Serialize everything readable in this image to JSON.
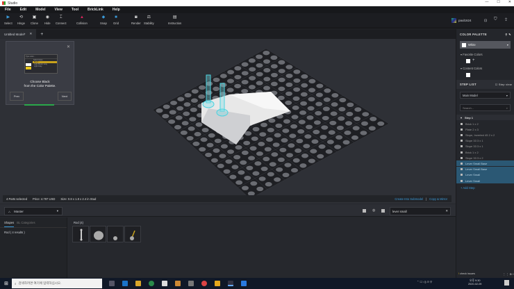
{
  "window": {
    "title": "Studio",
    "controls": [
      "—",
      "☐",
      "✕"
    ]
  },
  "menu": [
    "File",
    "Edit",
    "Model",
    "View",
    "Tool",
    "BrickLink",
    "Help"
  ],
  "toolbar": [
    {
      "label": "Select",
      "icon": "▶"
    },
    {
      "label": "Hinge",
      "icon": "⟲"
    },
    {
      "label": "Clone",
      "icon": "▣"
    },
    {
      "label": "Hide",
      "icon": "◉"
    },
    {
      "label": "Connect",
      "icon": "⌶"
    },
    {
      "label": "Collision",
      "icon": "▲"
    },
    {
      "label": "Snap",
      "icon": "◆"
    },
    {
      "label": "Grid",
      "icon": "■"
    },
    {
      "label": "Render",
      "icon": "◙"
    },
    {
      "label": "Stability",
      "icon": "⚖"
    },
    {
      "label": "Instruction",
      "icon": "▤"
    }
  ],
  "user": {
    "name": "paul1624"
  },
  "tabs": [
    {
      "label": "Untitled Model*"
    }
  ],
  "add_tab": "+",
  "tutorial": {
    "text1": "Choose Black",
    "text2": "from the Color Palette.",
    "prev": "Prev",
    "next": "Next",
    "close": "✕",
    "progress": 0.5,
    "mini": {
      "search": "Type color...",
      "group": "Solid Colors",
      "items": [
        "Black",
        "Light Bluish Gray",
        "Light Gray"
      ]
    }
  },
  "status": {
    "parts": "4 Parts selected",
    "price": "Price: 4.797 USD",
    "size": "Size: 0.8 x 1.8 x 2.4 in Stud",
    "link1": "Create Into Submodel",
    "sep": "|",
    "link2": "Copy & Mirror"
  },
  "bottom": {
    "master": "Master",
    "search_value": "lever small",
    "tab_shapes": "Shapes",
    "tab_bl": "BL Categories",
    "result": "Rod ( 4 results )",
    "group": "Rod (4)"
  },
  "palette": {
    "title": "COLOR PALETTE",
    "selected": "White",
    "favorite": "Favorite Colors",
    "content": "Content Colors",
    "add": "+"
  },
  "steplist": {
    "title": "STEP LIST",
    "step_view": "Step view",
    "model": "Main Model",
    "search_placeholder": "Search...",
    "step": "Step 1",
    "items": [
      {
        "label": "Brick 1 x 2",
        "selected": false
      },
      {
        "label": "Plate 2 x 3",
        "selected": false
      },
      {
        "label": "Slope, Inverted 45 2 x 2",
        "selected": false
      },
      {
        "label": "Slope 33 3 x 1",
        "selected": false
      },
      {
        "label": "Slope 33 3 x 1",
        "selected": false
      },
      {
        "label": "Brick 1 x 2",
        "selected": false
      },
      {
        "label": "Slope 33 3 x 2",
        "selected": false
      },
      {
        "label": "Lever Small Base",
        "selected": true
      },
      {
        "label": "Lever Small Base",
        "selected": true
      },
      {
        "label": "Lever Small",
        "selected": true
      },
      {
        "label": "Lever Small",
        "selected": true
      }
    ],
    "add_step": "+ Add Step",
    "check": "check issues"
  },
  "taskbar": {
    "search_placeholder": "검색하려면 여기에 입력하십시오.",
    "time": "오후 9:30",
    "date": "2020-02-09"
  },
  "colors": {
    "accent": "#3a9ad9",
    "selection": "#2b5874",
    "progress": "#2aa84a",
    "collision": "#e0245e"
  }
}
